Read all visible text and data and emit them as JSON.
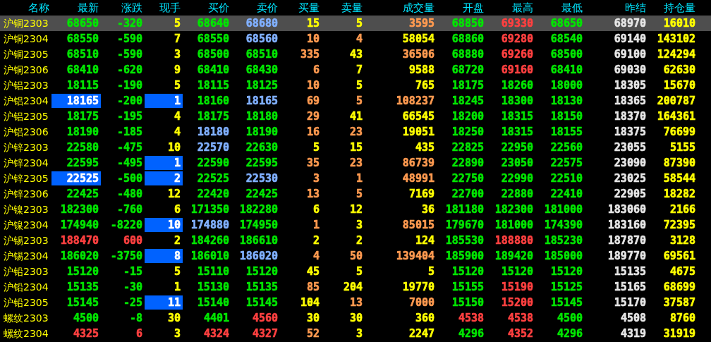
{
  "columns": [
    "名称",
    "最新",
    "涨跌",
    "现手",
    "买价",
    "卖价",
    "买量",
    "卖量",
    "成交量",
    "开盘",
    "最高",
    "最低",
    "昨结",
    "持仓量"
  ],
  "rows": [
    {
      "name": "沪铜2303",
      "selected": true,
      "cells": [
        {
          "text": "68650",
          "color": "#00e600",
          "highlighted": false
        },
        {
          "text": "-320",
          "color": "#00e600",
          "highlighted": false
        },
        {
          "text": "5",
          "color": "#ffff00",
          "highlighted": false
        },
        {
          "text": "68640",
          "color": "#00e600",
          "highlighted": false
        },
        {
          "text": "68680",
          "color": "#80b0ff",
          "highlighted": false
        },
        {
          "text": "15",
          "color": "#ffff00",
          "highlighted": false
        },
        {
          "text": "5",
          "color": "#ffff00",
          "highlighted": false
        },
        {
          "text": "3595",
          "color": "#ff9a50",
          "highlighted": false
        },
        {
          "text": "68850",
          "color": "#00e600",
          "highlighted": false
        },
        {
          "text": "69330",
          "color": "#ff4040",
          "highlighted": false
        },
        {
          "text": "68650",
          "color": "#00e600",
          "highlighted": false
        },
        {
          "text": "68970",
          "color": "#e6e6e6",
          "highlighted": false
        },
        {
          "text": "16010",
          "color": "#ffff00",
          "highlighted": false
        }
      ]
    },
    {
      "name": "沪铜2304",
      "selected": false,
      "cells": [
        {
          "text": "68550",
          "color": "#00e600",
          "highlighted": false
        },
        {
          "text": "-590",
          "color": "#00e600",
          "highlighted": false
        },
        {
          "text": "7",
          "color": "#ffff00",
          "highlighted": false
        },
        {
          "text": "68550",
          "color": "#00e600",
          "highlighted": false
        },
        {
          "text": "68560",
          "color": "#80b0ff",
          "highlighted": false
        },
        {
          "text": "10",
          "color": "#ff9a50",
          "highlighted": false
        },
        {
          "text": "4",
          "color": "#ff9a50",
          "highlighted": false
        },
        {
          "text": "58054",
          "color": "#ffff00",
          "highlighted": false
        },
        {
          "text": "68860",
          "color": "#00e600",
          "highlighted": false
        },
        {
          "text": "69280",
          "color": "#ff4040",
          "highlighted": false
        },
        {
          "text": "68540",
          "color": "#00e600",
          "highlighted": false
        },
        {
          "text": "69140",
          "color": "#e6e6e6",
          "highlighted": false
        },
        {
          "text": "143102",
          "color": "#ffff00",
          "highlighted": false
        }
      ]
    },
    {
      "name": "沪铜2305",
      "selected": false,
      "cells": [
        {
          "text": "68510",
          "color": "#00e600",
          "highlighted": false
        },
        {
          "text": "-590",
          "color": "#00e600",
          "highlighted": false
        },
        {
          "text": "3",
          "color": "#ffff00",
          "highlighted": false
        },
        {
          "text": "68500",
          "color": "#00e600",
          "highlighted": false
        },
        {
          "text": "68510",
          "color": "#00e600",
          "highlighted": false
        },
        {
          "text": "335",
          "color": "#ff9a50",
          "highlighted": false
        },
        {
          "text": "43",
          "color": "#ffff00",
          "highlighted": false
        },
        {
          "text": "36506",
          "color": "#ff9a50",
          "highlighted": false
        },
        {
          "text": "68880",
          "color": "#00e600",
          "highlighted": false
        },
        {
          "text": "69260",
          "color": "#ff4040",
          "highlighted": false
        },
        {
          "text": "68500",
          "color": "#00e600",
          "highlighted": false
        },
        {
          "text": "69100",
          "color": "#e6e6e6",
          "highlighted": false
        },
        {
          "text": "124294",
          "color": "#ffff00",
          "highlighted": false
        }
      ]
    },
    {
      "name": "沪铜2306",
      "selected": false,
      "cells": [
        {
          "text": "68410",
          "color": "#00e600",
          "highlighted": false
        },
        {
          "text": "-620",
          "color": "#00e600",
          "highlighted": false
        },
        {
          "text": "9",
          "color": "#ffff00",
          "highlighted": false
        },
        {
          "text": "68410",
          "color": "#00e600",
          "highlighted": false
        },
        {
          "text": "68430",
          "color": "#00e600",
          "highlighted": false
        },
        {
          "text": "6",
          "color": "#ff9a50",
          "highlighted": false
        },
        {
          "text": "7",
          "color": "#ffff00",
          "highlighted": false
        },
        {
          "text": "9588",
          "color": "#ffff00",
          "highlighted": false
        },
        {
          "text": "68720",
          "color": "#00e600",
          "highlighted": false
        },
        {
          "text": "69160",
          "color": "#ff4040",
          "highlighted": false
        },
        {
          "text": "68410",
          "color": "#00e600",
          "highlighted": false
        },
        {
          "text": "69030",
          "color": "#e6e6e6",
          "highlighted": false
        },
        {
          "text": "62630",
          "color": "#ffff00",
          "highlighted": false
        }
      ]
    },
    {
      "name": "沪铝2303",
      "selected": false,
      "cells": [
        {
          "text": "18115",
          "color": "#00e600",
          "highlighted": false
        },
        {
          "text": "-190",
          "color": "#00e600",
          "highlighted": false
        },
        {
          "text": "5",
          "color": "#ffff00",
          "highlighted": false
        },
        {
          "text": "18115",
          "color": "#00e600",
          "highlighted": false
        },
        {
          "text": "18125",
          "color": "#00e600",
          "highlighted": false
        },
        {
          "text": "10",
          "color": "#ff9a50",
          "highlighted": false
        },
        {
          "text": "5",
          "color": "#ffff00",
          "highlighted": false
        },
        {
          "text": "765",
          "color": "#ffff00",
          "highlighted": false
        },
        {
          "text": "18175",
          "color": "#00e600",
          "highlighted": false
        },
        {
          "text": "18260",
          "color": "#00e600",
          "highlighted": false
        },
        {
          "text": "18000",
          "color": "#00e600",
          "highlighted": false
        },
        {
          "text": "18305",
          "color": "#e6e6e6",
          "highlighted": false
        },
        {
          "text": "15670",
          "color": "#ffff00",
          "highlighted": false
        }
      ]
    },
    {
      "name": "沪铝2304",
      "selected": false,
      "cells": [
        {
          "text": "18165",
          "highlighted": true
        },
        {
          "text": "-200",
          "color": "#00e600",
          "highlighted": false
        },
        {
          "text": "1",
          "highlighted": true
        },
        {
          "text": "18160",
          "color": "#00e600",
          "highlighted": false
        },
        {
          "text": "18165",
          "color": "#80b0ff",
          "highlighted": false
        },
        {
          "text": "69",
          "color": "#ff9a50",
          "highlighted": false
        },
        {
          "text": "5",
          "color": "#ff9a50",
          "highlighted": false
        },
        {
          "text": "108237",
          "color": "#ff9a50",
          "highlighted": false
        },
        {
          "text": "18245",
          "color": "#00e600",
          "highlighted": false
        },
        {
          "text": "18300",
          "color": "#00e600",
          "highlighted": false
        },
        {
          "text": "18130",
          "color": "#00e600",
          "highlighted": false
        },
        {
          "text": "18365",
          "color": "#e6e6e6",
          "highlighted": false
        },
        {
          "text": "200787",
          "color": "#ffff00",
          "highlighted": false
        }
      ]
    },
    {
      "name": "沪铝2305",
      "selected": false,
      "cells": [
        {
          "text": "18175",
          "color": "#00e600",
          "highlighted": false
        },
        {
          "text": "-195",
          "color": "#00e600",
          "highlighted": false
        },
        {
          "text": "4",
          "color": "#ffff00",
          "highlighted": false
        },
        {
          "text": "18175",
          "color": "#00e600",
          "highlighted": false
        },
        {
          "text": "18180",
          "color": "#00e600",
          "highlighted": false
        },
        {
          "text": "29",
          "color": "#ff9a50",
          "highlighted": false
        },
        {
          "text": "41",
          "color": "#ffff00",
          "highlighted": false
        },
        {
          "text": "66545",
          "color": "#ffff00",
          "highlighted": false
        },
        {
          "text": "18200",
          "color": "#00e600",
          "highlighted": false
        },
        {
          "text": "18315",
          "color": "#00e600",
          "highlighted": false
        },
        {
          "text": "18150",
          "color": "#00e600",
          "highlighted": false
        },
        {
          "text": "18370",
          "color": "#e6e6e6",
          "highlighted": false
        },
        {
          "text": "164361",
          "color": "#ffff00",
          "highlighted": false
        }
      ]
    },
    {
      "name": "沪铝2306",
      "selected": false,
      "cells": [
        {
          "text": "18190",
          "color": "#00e600",
          "highlighted": false
        },
        {
          "text": "-185",
          "color": "#00e600",
          "highlighted": false
        },
        {
          "text": "4",
          "color": "#ffff00",
          "highlighted": false
        },
        {
          "text": "18180",
          "color": "#80b0ff",
          "highlighted": false
        },
        {
          "text": "18190",
          "color": "#00e600",
          "highlighted": false
        },
        {
          "text": "16",
          "color": "#ff9a50",
          "highlighted": false
        },
        {
          "text": "23",
          "color": "#ff9a50",
          "highlighted": false
        },
        {
          "text": "19051",
          "color": "#ffff00",
          "highlighted": false
        },
        {
          "text": "18250",
          "color": "#00e600",
          "highlighted": false
        },
        {
          "text": "18315",
          "color": "#00e600",
          "highlighted": false
        },
        {
          "text": "18155",
          "color": "#00e600",
          "highlighted": false
        },
        {
          "text": "18375",
          "color": "#e6e6e6",
          "highlighted": false
        },
        {
          "text": "76699",
          "color": "#ffff00",
          "highlighted": false
        }
      ]
    },
    {
      "name": "沪锌2303",
      "selected": false,
      "cells": [
        {
          "text": "22580",
          "color": "#00e600",
          "highlighted": false
        },
        {
          "text": "-475",
          "color": "#00e600",
          "highlighted": false
        },
        {
          "text": "10",
          "color": "#ffff00",
          "highlighted": false
        },
        {
          "text": "22570",
          "color": "#80b0ff",
          "highlighted": false
        },
        {
          "text": "22630",
          "color": "#00e600",
          "highlighted": false
        },
        {
          "text": "5",
          "color": "#ffff00",
          "highlighted": false
        },
        {
          "text": "15",
          "color": "#ffff00",
          "highlighted": false
        },
        {
          "text": "435",
          "color": "#ffff00",
          "highlighted": false
        },
        {
          "text": "22825",
          "color": "#00e600",
          "highlighted": false
        },
        {
          "text": "22950",
          "color": "#00e600",
          "highlighted": false
        },
        {
          "text": "22560",
          "color": "#00e600",
          "highlighted": false
        },
        {
          "text": "23055",
          "color": "#e6e6e6",
          "highlighted": false
        },
        {
          "text": "5155",
          "color": "#ffff00",
          "highlighted": false
        }
      ]
    },
    {
      "name": "沪锌2304",
      "selected": false,
      "cells": [
        {
          "text": "22595",
          "color": "#00e600",
          "highlighted": false
        },
        {
          "text": "-495",
          "color": "#00e600",
          "highlighted": false
        },
        {
          "text": "1",
          "highlighted": true
        },
        {
          "text": "22590",
          "color": "#00e600",
          "highlighted": false
        },
        {
          "text": "22595",
          "color": "#00e600",
          "highlighted": false
        },
        {
          "text": "35",
          "color": "#ff9a50",
          "highlighted": false
        },
        {
          "text": "23",
          "color": "#ff9a50",
          "highlighted": false
        },
        {
          "text": "86739",
          "color": "#ff9a50",
          "highlighted": false
        },
        {
          "text": "22890",
          "color": "#00e600",
          "highlighted": false
        },
        {
          "text": "23050",
          "color": "#00e600",
          "highlighted": false
        },
        {
          "text": "22575",
          "color": "#00e600",
          "highlighted": false
        },
        {
          "text": "23090",
          "color": "#e6e6e6",
          "highlighted": false
        },
        {
          "text": "87390",
          "color": "#ffff00",
          "highlighted": false
        }
      ]
    },
    {
      "name": "沪锌2305",
      "selected": false,
      "cells": [
        {
          "text": "22525",
          "highlighted": true
        },
        {
          "text": "-500",
          "color": "#00e600",
          "highlighted": false
        },
        {
          "text": "2",
          "highlighted": true
        },
        {
          "text": "22525",
          "color": "#00e600",
          "highlighted": false
        },
        {
          "text": "22530",
          "color": "#80b0ff",
          "highlighted": false
        },
        {
          "text": "3",
          "color": "#ff9a50",
          "highlighted": false
        },
        {
          "text": "1",
          "color": "#ff9a50",
          "highlighted": false
        },
        {
          "text": "48991",
          "color": "#ff9a50",
          "highlighted": false
        },
        {
          "text": "22750",
          "color": "#00e600",
          "highlighted": false
        },
        {
          "text": "22990",
          "color": "#00e600",
          "highlighted": false
        },
        {
          "text": "22510",
          "color": "#00e600",
          "highlighted": false
        },
        {
          "text": "23025",
          "color": "#e6e6e6",
          "highlighted": false
        },
        {
          "text": "58544",
          "color": "#ffff00",
          "highlighted": false
        }
      ]
    },
    {
      "name": "沪锌2306",
      "selected": false,
      "cells": [
        {
          "text": "22425",
          "color": "#00e600",
          "highlighted": false
        },
        {
          "text": "-480",
          "color": "#00e600",
          "highlighted": false
        },
        {
          "text": "12",
          "color": "#ffff00",
          "highlighted": false
        },
        {
          "text": "22420",
          "color": "#00e600",
          "highlighted": false
        },
        {
          "text": "22425",
          "color": "#00e600",
          "highlighted": false
        },
        {
          "text": "13",
          "color": "#ff9a50",
          "highlighted": false
        },
        {
          "text": "5",
          "color": "#ff9a50",
          "highlighted": false
        },
        {
          "text": "7169",
          "color": "#ffff00",
          "highlighted": false
        },
        {
          "text": "22700",
          "color": "#00e600",
          "highlighted": false
        },
        {
          "text": "22880",
          "color": "#00e600",
          "highlighted": false
        },
        {
          "text": "22410",
          "color": "#00e600",
          "highlighted": false
        },
        {
          "text": "22905",
          "color": "#e6e6e6",
          "highlighted": false
        },
        {
          "text": "18282",
          "color": "#ffff00",
          "highlighted": false
        }
      ]
    },
    {
      "name": "沪镍2303",
      "selected": false,
      "cells": [
        {
          "text": "182300",
          "color": "#00e600",
          "highlighted": false
        },
        {
          "text": "-760",
          "color": "#00e600",
          "highlighted": false
        },
        {
          "text": "6",
          "color": "#ffff00",
          "highlighted": false
        },
        {
          "text": "171350",
          "color": "#00e600",
          "highlighted": false
        },
        {
          "text": "182280",
          "color": "#00e600",
          "highlighted": false
        },
        {
          "text": "6",
          "color": "#ffff00",
          "highlighted": false
        },
        {
          "text": "12",
          "color": "#ffff00",
          "highlighted": false
        },
        {
          "text": "36",
          "color": "#ffff00",
          "highlighted": false
        },
        {
          "text": "181180",
          "color": "#00e600",
          "highlighted": false
        },
        {
          "text": "182300",
          "color": "#00e600",
          "highlighted": false
        },
        {
          "text": "181000",
          "color": "#00e600",
          "highlighted": false
        },
        {
          "text": "183060",
          "color": "#e6e6e6",
          "highlighted": false
        },
        {
          "text": "2166",
          "color": "#ffff00",
          "highlighted": false
        }
      ]
    },
    {
      "name": "沪镍2304",
      "selected": false,
      "cells": [
        {
          "text": "174940",
          "color": "#00e600",
          "highlighted": false
        },
        {
          "text": "-8220",
          "color": "#00e600",
          "highlighted": false
        },
        {
          "text": "10",
          "highlighted": true
        },
        {
          "text": "174880",
          "color": "#80b0ff",
          "highlighted": false
        },
        {
          "text": "174950",
          "color": "#00e600",
          "highlighted": false
        },
        {
          "text": "1",
          "color": "#ff9a50",
          "highlighted": false
        },
        {
          "text": "3",
          "color": "#ffff00",
          "highlighted": false
        },
        {
          "text": "85015",
          "color": "#ff9a50",
          "highlighted": false
        },
        {
          "text": "179670",
          "color": "#00e600",
          "highlighted": false
        },
        {
          "text": "181000",
          "color": "#00e600",
          "highlighted": false
        },
        {
          "text": "174390",
          "color": "#00e600",
          "highlighted": false
        },
        {
          "text": "183160",
          "color": "#e6e6e6",
          "highlighted": false
        },
        {
          "text": "72395",
          "color": "#ffff00",
          "highlighted": false
        }
      ]
    },
    {
      "name": "沪锡2303",
      "selected": false,
      "cells": [
        {
          "text": "188470",
          "color": "#ff4040",
          "highlighted": false
        },
        {
          "text": "600",
          "color": "#ff4040",
          "highlighted": false
        },
        {
          "text": "2",
          "color": "#ffff00",
          "highlighted": false
        },
        {
          "text": "184260",
          "color": "#00e600",
          "highlighted": false
        },
        {
          "text": "186610",
          "color": "#00e600",
          "highlighted": false
        },
        {
          "text": "2",
          "color": "#ffff00",
          "highlighted": false
        },
        {
          "text": "2",
          "color": "#ffff00",
          "highlighted": false
        },
        {
          "text": "124",
          "color": "#ffff00",
          "highlighted": false
        },
        {
          "text": "185530",
          "color": "#00e600",
          "highlighted": false
        },
        {
          "text": "188880",
          "color": "#ff4040",
          "highlighted": false
        },
        {
          "text": "185230",
          "color": "#00e600",
          "highlighted": false
        },
        {
          "text": "187870",
          "color": "#e6e6e6",
          "highlighted": false
        },
        {
          "text": "3128",
          "color": "#ffff00",
          "highlighted": false
        }
      ]
    },
    {
      "name": "沪锡2304",
      "selected": false,
      "cells": [
        {
          "text": "186020",
          "color": "#00e600",
          "highlighted": false
        },
        {
          "text": "-3750",
          "color": "#00e600",
          "highlighted": false
        },
        {
          "text": "8",
          "highlighted": true
        },
        {
          "text": "186010",
          "color": "#00e600",
          "highlighted": false
        },
        {
          "text": "186020",
          "color": "#80b0ff",
          "highlighted": false
        },
        {
          "text": "4",
          "color": "#ff9a50",
          "highlighted": false
        },
        {
          "text": "50",
          "color": "#ff9a50",
          "highlighted": false
        },
        {
          "text": "139404",
          "color": "#ff9a50",
          "highlighted": false
        },
        {
          "text": "185900",
          "color": "#00e600",
          "highlighted": false
        },
        {
          "text": "189420",
          "color": "#00e600",
          "highlighted": false
        },
        {
          "text": "185000",
          "color": "#00e600",
          "highlighted": false
        },
        {
          "text": "189770",
          "color": "#e6e6e6",
          "highlighted": false
        },
        {
          "text": "69561",
          "color": "#ffff00",
          "highlighted": false
        }
      ]
    },
    {
      "name": "沪铅2303",
      "selected": false,
      "cells": [
        {
          "text": "15120",
          "color": "#00e600",
          "highlighted": false
        },
        {
          "text": "-15",
          "color": "#00e600",
          "highlighted": false
        },
        {
          "text": "5",
          "color": "#ffff00",
          "highlighted": false
        },
        {
          "text": "15110",
          "color": "#00e600",
          "highlighted": false
        },
        {
          "text": "15120",
          "color": "#00e600",
          "highlighted": false
        },
        {
          "text": "45",
          "color": "#ffff00",
          "highlighted": false
        },
        {
          "text": "5",
          "color": "#ffff00",
          "highlighted": false
        },
        {
          "text": "5",
          "color": "#ffff00",
          "highlighted": false
        },
        {
          "text": "15120",
          "color": "#00e600",
          "highlighted": false
        },
        {
          "text": "15120",
          "color": "#00e600",
          "highlighted": false
        },
        {
          "text": "15120",
          "color": "#00e600",
          "highlighted": false
        },
        {
          "text": "15135",
          "color": "#e6e6e6",
          "highlighted": false
        },
        {
          "text": "4675",
          "color": "#ffff00",
          "highlighted": false
        }
      ]
    },
    {
      "name": "沪铅2304",
      "selected": false,
      "cells": [
        {
          "text": "15135",
          "color": "#00e600",
          "highlighted": false
        },
        {
          "text": "-30",
          "color": "#00e600",
          "highlighted": false
        },
        {
          "text": "1",
          "color": "#ffff00",
          "highlighted": false
        },
        {
          "text": "15130",
          "color": "#00e600",
          "highlighted": false
        },
        {
          "text": "15135",
          "color": "#00e600",
          "highlighted": false
        },
        {
          "text": "85",
          "color": "#ff9a50",
          "highlighted": false
        },
        {
          "text": "204",
          "color": "#ffff00",
          "highlighted": false
        },
        {
          "text": "19770",
          "color": "#ffff00",
          "highlighted": false
        },
        {
          "text": "15155",
          "color": "#00e600",
          "highlighted": false
        },
        {
          "text": "15190",
          "color": "#ff4040",
          "highlighted": false
        },
        {
          "text": "15125",
          "color": "#00e600",
          "highlighted": false
        },
        {
          "text": "15165",
          "color": "#e6e6e6",
          "highlighted": false
        },
        {
          "text": "68699",
          "color": "#ffff00",
          "highlighted": false
        }
      ]
    },
    {
      "name": "沪铅2305",
      "selected": false,
      "cells": [
        {
          "text": "15145",
          "color": "#00e600",
          "highlighted": false
        },
        {
          "text": "-25",
          "color": "#00e600",
          "highlighted": false
        },
        {
          "text": "11",
          "highlighted": true
        },
        {
          "text": "15140",
          "color": "#00e600",
          "highlighted": false
        },
        {
          "text": "15145",
          "color": "#00e600",
          "highlighted": false
        },
        {
          "text": "104",
          "color": "#ffff00",
          "highlighted": false
        },
        {
          "text": "13",
          "color": "#ff9a50",
          "highlighted": false
        },
        {
          "text": "7000",
          "color": "#ff9a50",
          "highlighted": false
        },
        {
          "text": "15150",
          "color": "#00e600",
          "highlighted": false
        },
        {
          "text": "15200",
          "color": "#ff4040",
          "highlighted": false
        },
        {
          "text": "15145",
          "color": "#00e600",
          "highlighted": false
        },
        {
          "text": "15170",
          "color": "#e6e6e6",
          "highlighted": false
        },
        {
          "text": "37587",
          "color": "#ffff00",
          "highlighted": false
        }
      ]
    },
    {
      "name": "螺纹2303",
      "selected": false,
      "cells": [
        {
          "text": "4500",
          "color": "#00e600",
          "highlighted": false
        },
        {
          "text": "-8",
          "color": "#00e600",
          "highlighted": false
        },
        {
          "text": "30",
          "color": "#ffff00",
          "highlighted": false
        },
        {
          "text": "4401",
          "color": "#00e600",
          "highlighted": false
        },
        {
          "text": "4560",
          "color": "#ff4040",
          "highlighted": false
        },
        {
          "text": "30",
          "color": "#ffff00",
          "highlighted": false
        },
        {
          "text": "30",
          "color": "#ffff00",
          "highlighted": false
        },
        {
          "text": "360",
          "color": "#ffff00",
          "highlighted": false
        },
        {
          "text": "4538",
          "color": "#ff4040",
          "highlighted": false
        },
        {
          "text": "4538",
          "color": "#ff4040",
          "highlighted": false
        },
        {
          "text": "4500",
          "color": "#00e600",
          "highlighted": false
        },
        {
          "text": "4508",
          "color": "#e6e6e6",
          "highlighted": false
        },
        {
          "text": "8760",
          "color": "#ffff00",
          "highlighted": false
        }
      ]
    },
    {
      "name": "螺纹2304",
      "selected": false,
      "cells": [
        {
          "text": "4325",
          "color": "#ff4040",
          "highlighted": false
        },
        {
          "text": "6",
          "color": "#ff4040",
          "highlighted": false
        },
        {
          "text": "3",
          "color": "#ffff00",
          "highlighted": false
        },
        {
          "text": "4324",
          "color": "#ff4040",
          "highlighted": false
        },
        {
          "text": "4327",
          "color": "#ff4040",
          "highlighted": false
        },
        {
          "text": "52",
          "color": "#ff9a50",
          "highlighted": false
        },
        {
          "text": "3",
          "color": "#ffff00",
          "highlighted": false
        },
        {
          "text": "2247",
          "color": "#ffff00",
          "highlighted": false
        },
        {
          "text": "4296",
          "color": "#00e600",
          "highlighted": false
        },
        {
          "text": "4352",
          "color": "#ff4040",
          "highlighted": false
        },
        {
          "text": "4296",
          "color": "#00e600",
          "highlighted": false
        },
        {
          "text": "4319",
          "color": "#e6e6e6",
          "highlighted": false
        },
        {
          "text": "31919",
          "color": "#ffff00",
          "highlighted": false
        }
      ]
    }
  ]
}
